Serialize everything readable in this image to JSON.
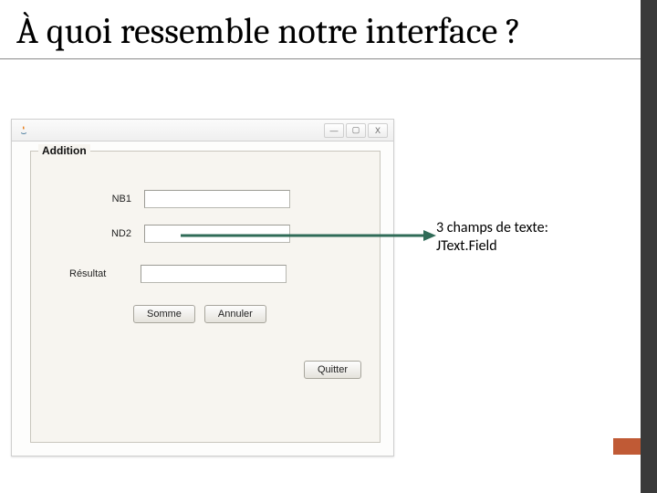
{
  "slide": {
    "title": "À quoi ressemble notre interface ?"
  },
  "window": {
    "icon_name": "java-icon",
    "controls": {
      "minimize": "—",
      "maximize": "▢",
      "close": "X"
    }
  },
  "panel": {
    "title": "Addition",
    "fields": {
      "nb1": {
        "label": "NB1",
        "value": ""
      },
      "nd2": {
        "label": "ND2",
        "value": ""
      },
      "result": {
        "label": "Résultat",
        "value": ""
      }
    },
    "buttons": {
      "somme": "Somme",
      "annuler": "Annuler",
      "quitter": "Quitter"
    }
  },
  "annotation": {
    "line1": "3 champs de texte:",
    "line2": "JText.Field"
  }
}
